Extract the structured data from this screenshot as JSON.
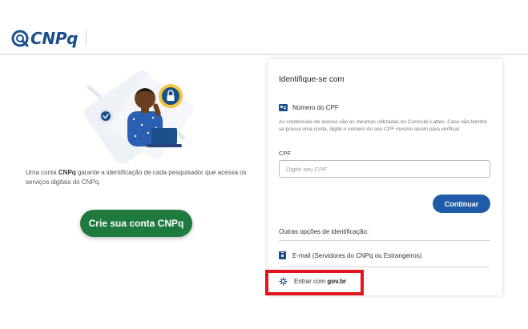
{
  "brand": {
    "name": "CNPq",
    "color": "#1b4f8c"
  },
  "intro": {
    "before": "Uma conta ",
    "bold": "CNPq",
    "after": " garante a identificação de cada pesquisador que acessa os serviços digitais do CNPq."
  },
  "create_button": {
    "label": "Crie sua conta CNPq",
    "color": "#1f7a3f"
  },
  "login": {
    "title": "Identifique-se com",
    "cpf_option": {
      "label": "Número do CPF",
      "icon": "id-card-icon"
    },
    "help_text": "As credenciais de acesso são as mesmas utilizadas no Currículo Lattes. Caso não lembre se possui uma conta, digite o número do seu CPF mesmo assim para verificar.",
    "cpf_field": {
      "label": "CPF",
      "value": "",
      "placeholder": "Digite seu CPF"
    },
    "continue_button": {
      "label": "Continuar",
      "color": "#1f5ba8"
    },
    "other_options_title": "Outras opções de identificação:",
    "email_option": {
      "label": "E-mail (Servidores do CNPq ou Estrangeiros)",
      "icon": "badge-icon"
    },
    "govbr_option": {
      "label_prefix": "Entrar com ",
      "label_bold": "gov.br",
      "icon": "govbr-icon"
    }
  },
  "highlight_color": "#e3141b"
}
